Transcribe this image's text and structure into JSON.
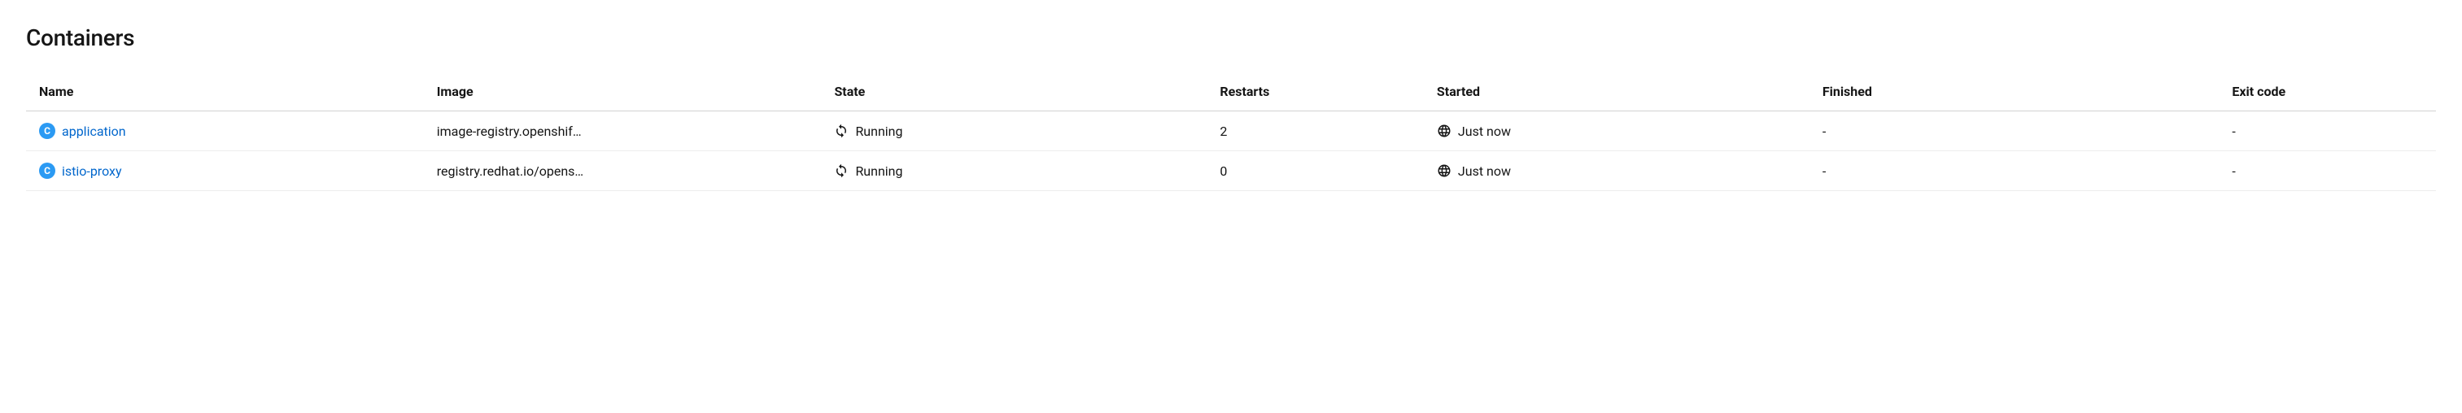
{
  "section_title": "Containers",
  "columns": {
    "name": "Name",
    "image": "Image",
    "state": "State",
    "restarts": "Restarts",
    "started": "Started",
    "finished": "Finished",
    "exit_code": "Exit code"
  },
  "badge_letter": "C",
  "rows": [
    {
      "name": "application",
      "image": "image-registry.openshif…",
      "state": "Running",
      "restarts": "2",
      "started": "Just now",
      "finished": "-",
      "exit_code": "-"
    },
    {
      "name": "istio-proxy",
      "image": "registry.redhat.io/opens…",
      "state": "Running",
      "restarts": "0",
      "started": "Just now",
      "finished": "-",
      "exit_code": "-"
    }
  ]
}
